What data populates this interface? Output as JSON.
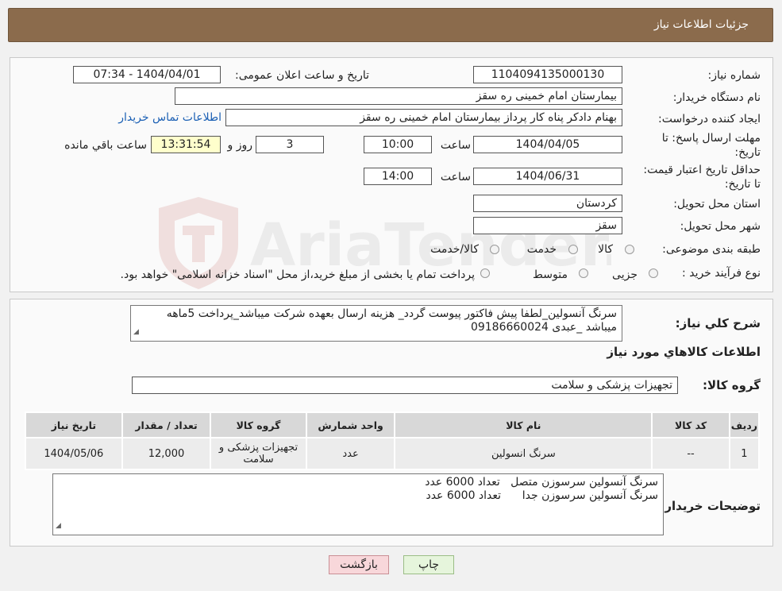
{
  "header": {
    "title": "جزئیات اطلاعات نیاز"
  },
  "fields": {
    "need_number_label": "شماره نیاز:",
    "need_number": "1104094135000130",
    "announce_label": "تاریخ و ساعت اعلان عمومی:",
    "announce_value": "1404/04/01 - 07:34",
    "buyer_org_label": "نام دستگاه خریدار:",
    "buyer_org": "بیمارستان امام خمینی  ره  سقز",
    "creator_label": "ایجاد کننده درخواست:",
    "creator": "بهنام دادکر پناه کار پرداز بیمارستان امام خمینی  ره  سقز",
    "contact_link": "اطلاعات تماس خریدار",
    "deadline_label": "مهلت ارسال پاسخ: تا تاریخ:",
    "deadline_date": "1404/04/05",
    "time_label": "ساعت",
    "deadline_time": "10:00",
    "days_value": "3",
    "days_label": "روز و",
    "remaining_time": "13:31:54",
    "remaining_label": "ساعت باقي مانده",
    "validity_label": "حداقل تاریخ اعتبار قیمت: تا تاریخ:",
    "validity_date": "1404/06/31",
    "validity_time": "14:00",
    "province_label": "استان محل تحویل:",
    "province": "کردستان",
    "city_label": "شهر محل تحویل:",
    "city": "سقز",
    "category_label": "طبقه بندی موضوعی:",
    "category_options": [
      "کالا",
      "خدمت",
      "کالا/خدمت"
    ],
    "purchase_type_label": "نوع فرآیند خرید :",
    "purchase_options": [
      "جزیی",
      "متوسط"
    ],
    "purchase_note": "پرداخت تمام یا بخشی از مبلغ خرید،از محل \"اسناد خزانه اسلامی\" خواهد بود."
  },
  "watermark": {
    "text": "AriaTender.neT"
  },
  "description": {
    "label": "شرح کلي نياز:",
    "text": "سرنگ آنسولین_لطفا پیش فاکتور پیوست گردد_ هزینه ارسال بعهده شرکت میباشد_پرداخت 5ماهه میباشد _عبدی 09186660024"
  },
  "goods_section": {
    "title": "اطلاعات كالاهاي مورد نياز",
    "group_label": "گروه کالا:",
    "group_value": "تجهیزات پزشکی و سلامت"
  },
  "table": {
    "headers": [
      "ردیف",
      "کد کالا",
      "نام کالا",
      "واحد شمارش",
      "گروه کالا",
      "تعداد / مقدار",
      "تاریخ نیاز"
    ],
    "rows": [
      [
        "1",
        "--",
        "سرنگ انسولین",
        "عدد",
        "تجهیزات پزشکی و سلامت",
        "12,000",
        "1404/05/06"
      ]
    ]
  },
  "buyer_notes": {
    "label": "توضیحات خریدار:",
    "line1": "سرنگ آنسولین سرسوزن متصل   تعداد 6000 عدد",
    "line2": "سرنگ آنسولین سرسوزن جدا      تعداد 6000 عدد"
  },
  "buttons": {
    "print": "چاپ",
    "back": "بازگشت"
  },
  "colors": {
    "title_bar": "#8b6b4c",
    "link": "#1a5fb4",
    "remaining_bg": "#ffffcc",
    "back_btn": "#f8d7da",
    "print_btn": "#e6f5dc"
  }
}
